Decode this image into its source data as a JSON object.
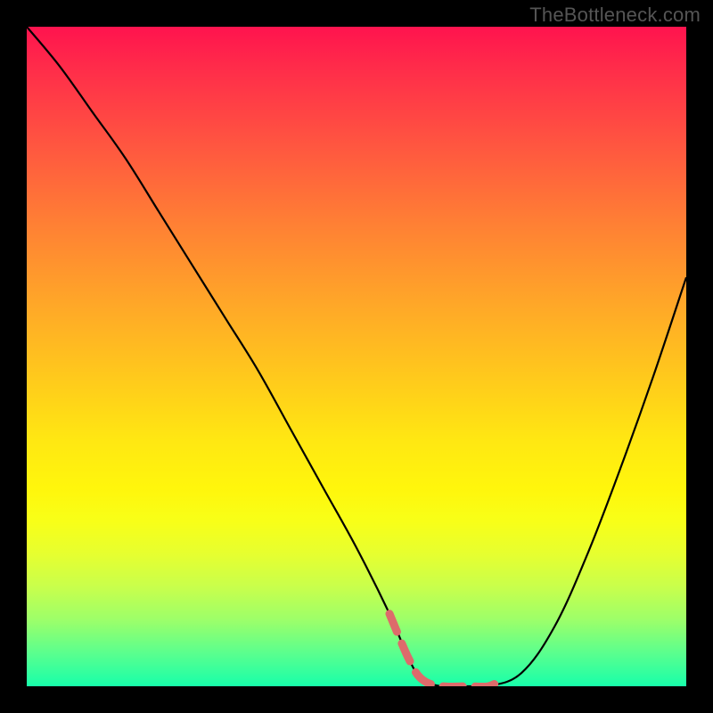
{
  "watermark": "TheBottleneck.com",
  "chart_data": {
    "type": "line",
    "title": "",
    "xlabel": "",
    "ylabel": "",
    "xlim": [
      0,
      100
    ],
    "ylim": [
      0,
      100
    ],
    "grid": false,
    "legend": false,
    "notes": "Bottleneck curve on a rainbow heat background. Low y = green/good, high y = red/bad. Trough marks the balanced range.",
    "series": [
      {
        "name": "bottleneck-curve",
        "color": "#000000",
        "x": [
          0,
          5,
          10,
          15,
          20,
          25,
          30,
          35,
          40,
          45,
          50,
          55,
          58,
          60,
          63,
          67,
          70,
          75,
          80,
          85,
          90,
          95,
          100
        ],
        "y": [
          100,
          94,
          87,
          80,
          72,
          64,
          56,
          48,
          39,
          30,
          21,
          11,
          4,
          1,
          0,
          0,
          0,
          2,
          9,
          20,
          33,
          47,
          62
        ]
      },
      {
        "name": "optimal-trough-marker",
        "color": "#e06666",
        "marker": "dashed-segments",
        "x": [
          55,
          58,
          60,
          63,
          67,
          70,
          72
        ],
        "y": [
          11,
          4,
          1,
          0,
          0,
          0,
          1
        ]
      }
    ],
    "background_gradient": {
      "direction": "top-to-bottom",
      "stops": [
        {
          "pos": 0.0,
          "color": "#ff134e"
        },
        {
          "pos": 0.3,
          "color": "#ff8034"
        },
        {
          "pos": 0.55,
          "color": "#ffcf1a"
        },
        {
          "pos": 0.75,
          "color": "#f8ff18"
        },
        {
          "pos": 0.9,
          "color": "#9cff6a"
        },
        {
          "pos": 1.0,
          "color": "#18ffaa"
        }
      ]
    }
  }
}
